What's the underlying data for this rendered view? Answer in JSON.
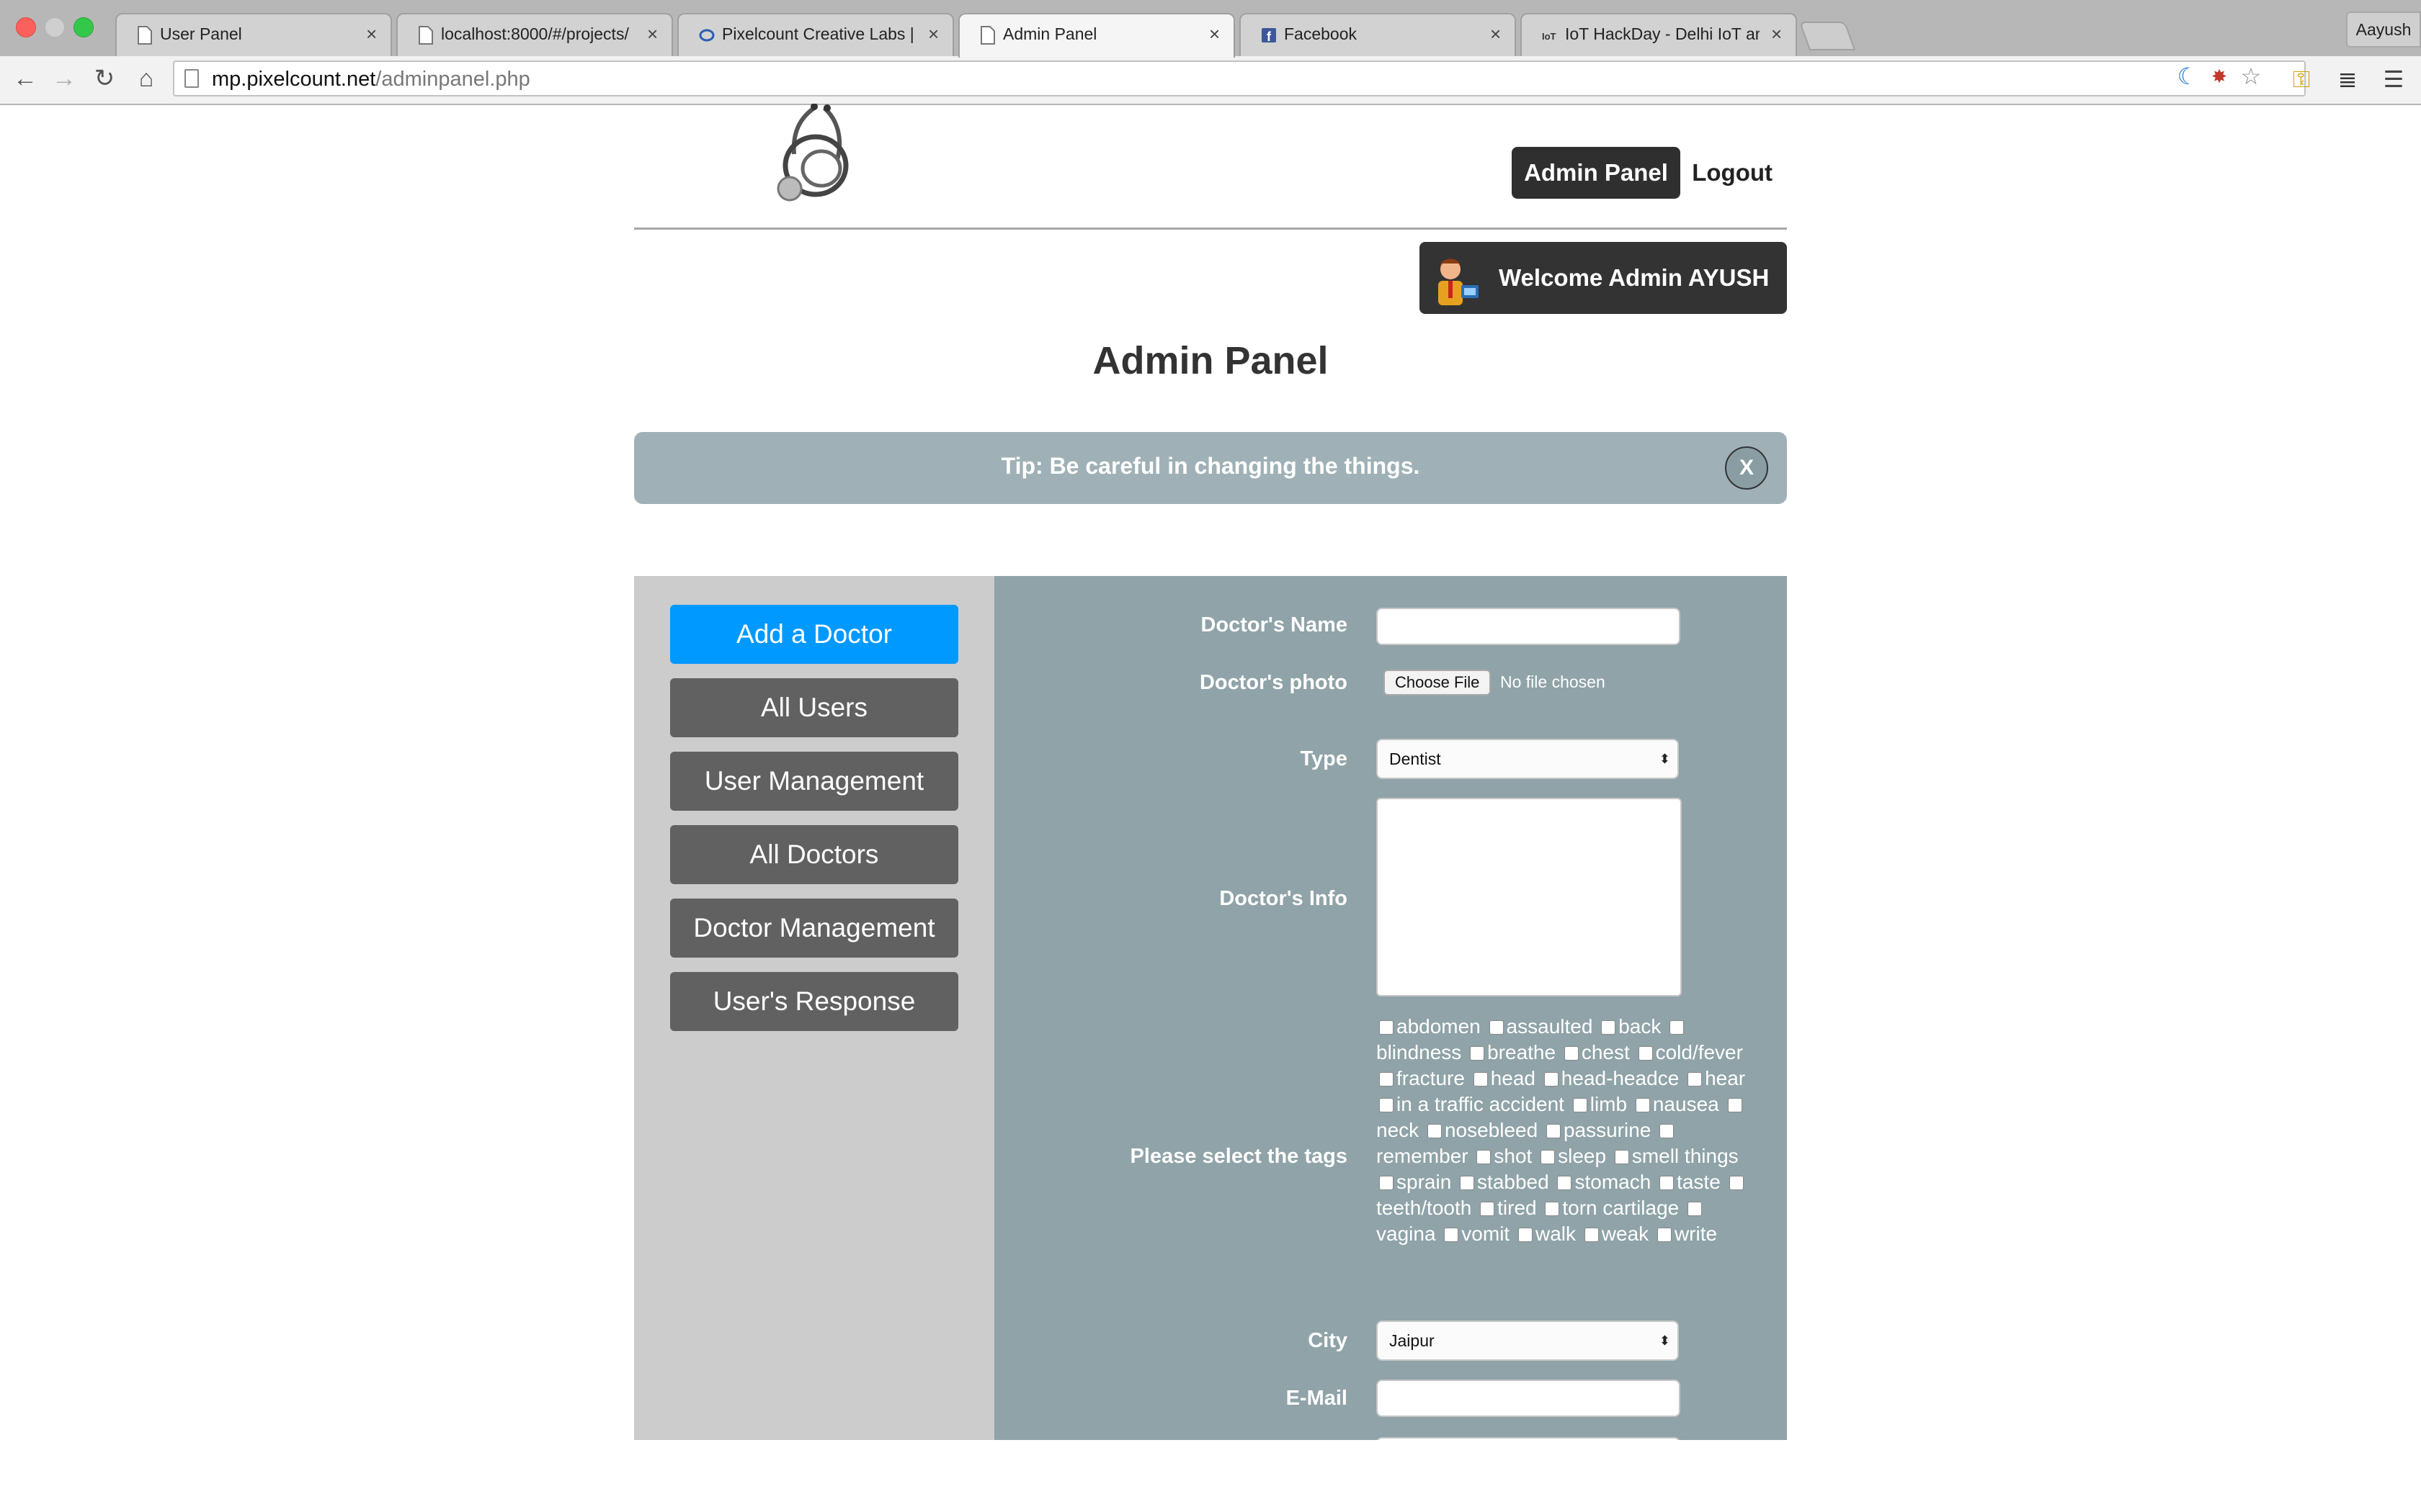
{
  "browser": {
    "tabs": [
      {
        "title": "User Panel",
        "close": "×"
      },
      {
        "title": "localhost:8000/#/projects/",
        "close": "×"
      },
      {
        "title": "Pixelcount Creative Labs | W",
        "close": "×"
      },
      {
        "title": "Admin Panel",
        "close": "×"
      },
      {
        "title": "Facebook",
        "close": "×"
      },
      {
        "title": "IoT HackDay - Delhi IoT and",
        "close": "×"
      }
    ],
    "profile": "Aayush",
    "url_host": "mp.pixelcount.net",
    "url_path": "/adminpanel.php"
  },
  "header": {
    "admin_panel": "Admin Panel",
    "logout": "Logout",
    "welcome": "Welcome Admin AYUSH"
  },
  "page_title": "Admin Panel",
  "tip": {
    "text": "Tip: Be careful in changing the things.",
    "close": "X"
  },
  "sidebar": {
    "items": [
      "Add a Doctor",
      "All Users",
      "User Management",
      "All Doctors",
      "Doctor Management",
      "User's Response"
    ]
  },
  "form": {
    "name_label": "Doctor's Name",
    "name_value": "",
    "photo_label": "Doctor's photo",
    "choose_file": "Choose File",
    "no_file": "No file chosen",
    "type_label": "Type",
    "type_value": "Dentist",
    "info_label": "Doctor's Info",
    "tags_label": "Please select the tags",
    "tags": [
      "abdomen",
      "assaulted",
      "back",
      "blindness",
      "breathe",
      "chest",
      "cold/fever",
      "fracture",
      "head",
      "head-headce",
      "hear",
      "in a traffic accident",
      "limb",
      "nausea",
      "neck",
      "nosebleed",
      "passurine",
      "remember",
      "shot",
      "sleep",
      "smell things",
      "sprain",
      "stabbed",
      "stomach",
      "taste",
      "teeth/tooth",
      "tired",
      "torn cartilage",
      "vagina",
      "vomit",
      "walk",
      "weak",
      "write"
    ],
    "city_label": "City",
    "city_value": "Jaipur",
    "email_label": "E-Mail"
  },
  "colors": {
    "active_nav": "#0099ff",
    "nav_button": "#616161",
    "form_bg": "#8fa3a8",
    "tip_bg": "#9fb1b6"
  }
}
